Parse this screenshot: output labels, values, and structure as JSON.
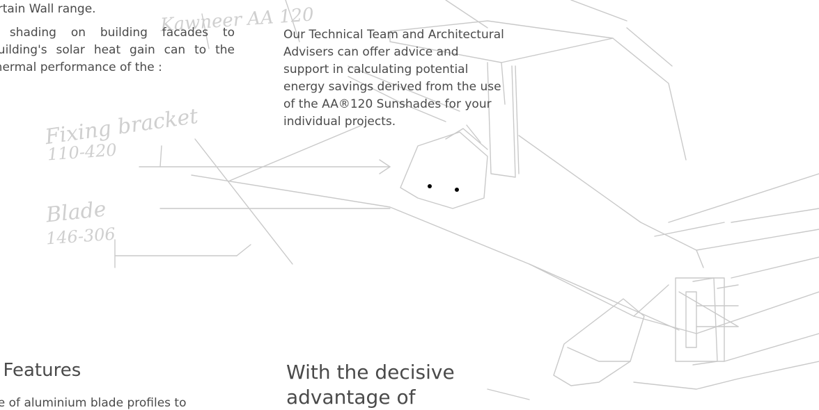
{
  "left_column": {
    "intro_fragment": "urtain Wall range.",
    "paragraph": "r shading on building facades to building's solar heat gain can to the thermal performance of the :"
  },
  "middle_column": {
    "paragraph": "Our Technical Team and Architectural Advisers can offer advice and support in calculating potential energy savings derived from the use of the AA®120 Sunshades for your individual projects."
  },
  "sketch_labels": {
    "product": "Kawneer AA 120",
    "fixing_bracket": "Fixing bracket",
    "fixing_bracket_range": "110-420",
    "blade": "Blade",
    "blade_range": "146-306"
  },
  "sections": {
    "features_heading": "t Features",
    "features_text": "ge of aluminium blade profiles to",
    "advantage_heading": "With the decisive advantage of"
  }
}
